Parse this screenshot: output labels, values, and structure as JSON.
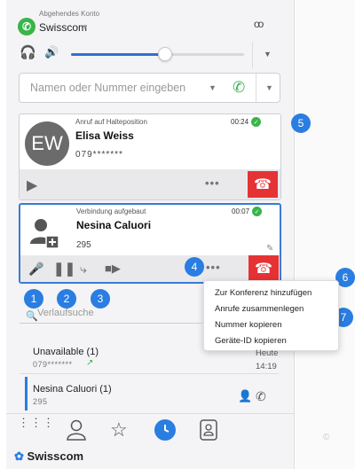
{
  "account": {
    "caption": "Abgehendes Konto",
    "name": "Swisscom",
    "icon": "phone-app-icon"
  },
  "volume": {
    "level": 0.55
  },
  "search": {
    "placeholder": "Namen oder Nummer eingeben",
    "value": ""
  },
  "calls": [
    {
      "initials": "EW",
      "status": "Anruf auf Halteposition",
      "duration": "00:24",
      "name": "Elisa Weiss",
      "number": "079*******"
    },
    {
      "status": "Verbindung aufgebaut",
      "duration": "00:07",
      "name": "Nesina Caluori",
      "number": "295"
    }
  ],
  "context_menu": {
    "items": [
      "Zur Konferenz hinzufügen",
      "Anrufe zusammenlegen",
      "Nummer kopieren",
      "Geräte-ID kopieren"
    ]
  },
  "badges": [
    "1",
    "2",
    "3",
    "4",
    "5",
    "6",
    "7"
  ],
  "history": {
    "search_placeholder": "Verlaufsuche",
    "entries": [
      {
        "name": "Unavailable (1)",
        "number": "079*******",
        "day": "Heute",
        "time": "14:19"
      },
      {
        "name": "Nesina Caluori (1)",
        "number": "295"
      }
    ]
  },
  "brand": "Swisscom",
  "colors": {
    "accent": "#2a7de1",
    "call_green": "#39b54a",
    "hangup_red": "#e53235"
  }
}
